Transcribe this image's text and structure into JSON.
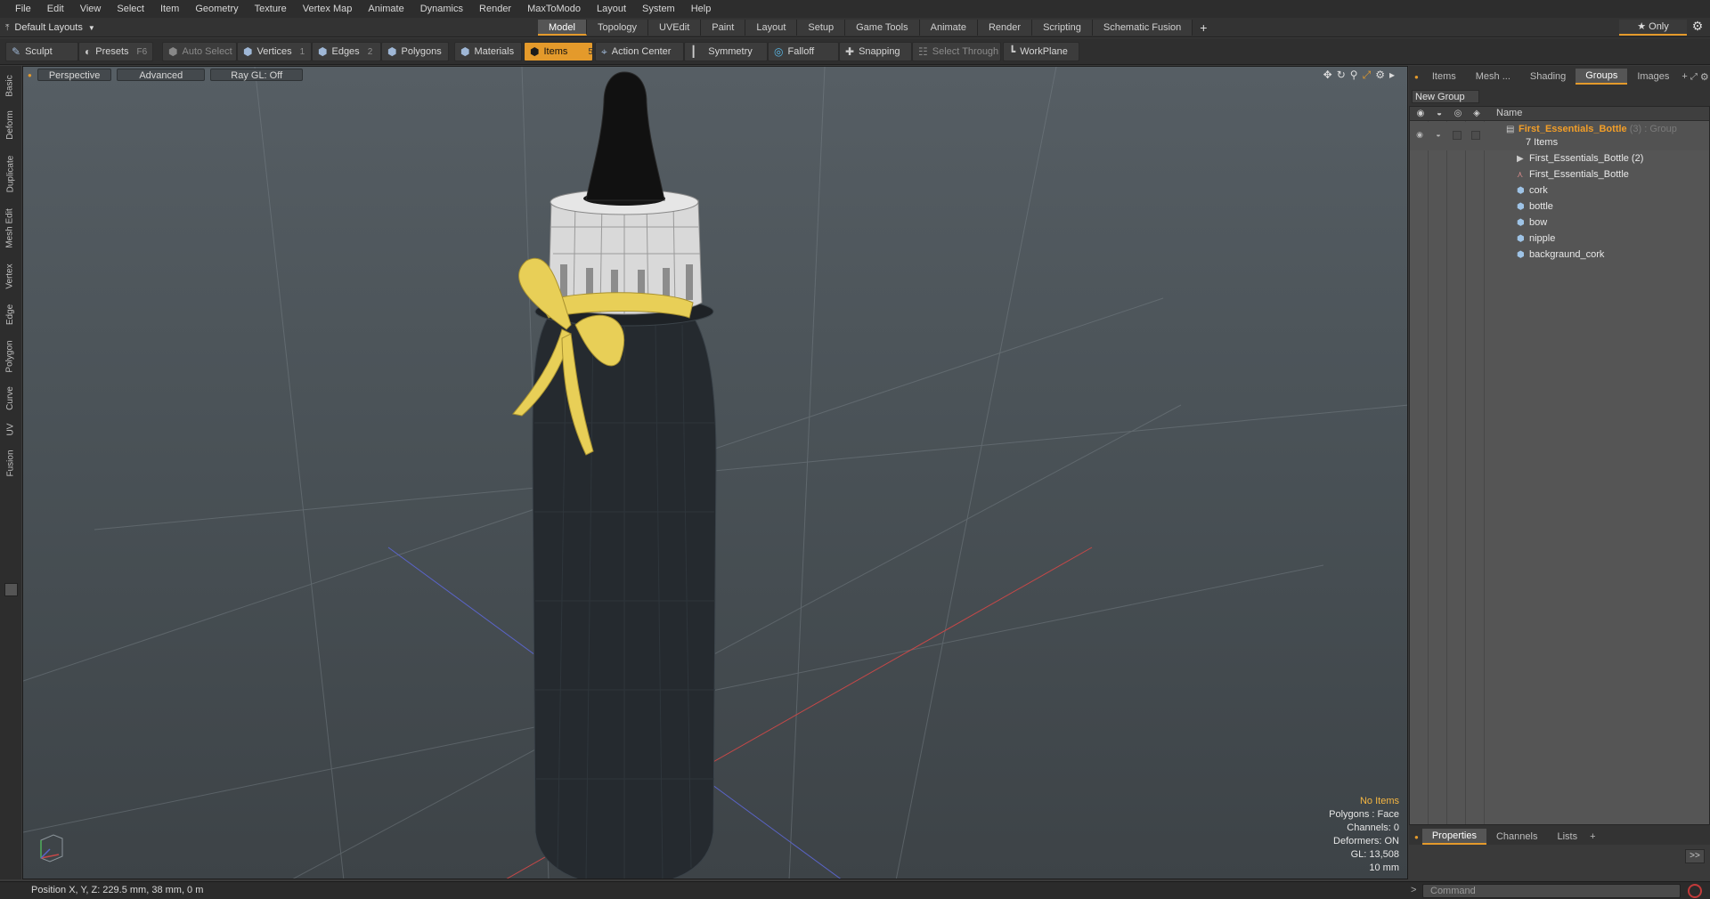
{
  "menubar": {
    "items": [
      "File",
      "Edit",
      "View",
      "Select",
      "Item",
      "Geometry",
      "Texture",
      "Vertex Map",
      "Animate",
      "Dynamics",
      "Render",
      "MaxToModo",
      "Layout",
      "System",
      "Help"
    ]
  },
  "layoutbar": {
    "layout_name": "Default Layouts",
    "tabs": [
      "Model",
      "Topology",
      "UVEdit",
      "Paint",
      "Layout",
      "Setup",
      "Game Tools",
      "Animate",
      "Render",
      "Scripting",
      "Schematic Fusion"
    ],
    "active_tab": "Model",
    "add_label": "+",
    "only_label": "★  Only"
  },
  "toolbar": {
    "sculpt": "Sculpt",
    "presets": "Presets",
    "presets_key": "F6",
    "auto_select": "Auto Select",
    "vertices": "Vertices",
    "vertices_key": "1",
    "edges": "Edges",
    "edges_key": "2",
    "polygons": "Polygons",
    "materials": "Materials",
    "items": "Items",
    "items_key": "5",
    "action_center": "Action Center",
    "symmetry": "Symmetry",
    "falloff": "Falloff",
    "snapping": "Snapping",
    "select_through": "Select Through",
    "workplane": "WorkPlane"
  },
  "left_tabs": [
    "Basic",
    "Deform",
    "Duplicate",
    "Mesh Edit",
    "Vertex",
    "Edge",
    "Polygon",
    "Curve",
    "UV",
    "Fusion"
  ],
  "viewport": {
    "view_label": "Perspective",
    "shading_label": "Advanced",
    "raygl_label": "Ray GL: Off",
    "stats": {
      "items": "No Items",
      "polygons": "Polygons : Face",
      "channels": "Channels: 0",
      "deformers": "Deformers: ON",
      "gl": "GL: 13,508",
      "grid": "10 mm"
    }
  },
  "right_panel": {
    "tabs": [
      "Items",
      "Mesh ...",
      "Shading",
      "Groups",
      "Images"
    ],
    "active_tab": "Groups",
    "new_group": "New Group",
    "name_header": "Name",
    "group": {
      "name": "First_Essentials_Bottle",
      "count_suffix": "(3) : Group",
      "items_count": "7 Items"
    },
    "items": [
      "First_Essentials_Bottle (2)",
      "First_Essentials_Bottle",
      "cork",
      "bottle",
      "bow",
      "nipple",
      "backgraund_cork"
    ],
    "bottom_tabs": [
      "Properties",
      "Channels",
      "Lists"
    ],
    "bottom_active": "Properties"
  },
  "statusbar": {
    "position_text": "Position X, Y, Z:   229.5 mm, 38 mm, 0 m",
    "command_placeholder": "Command",
    "prompt": ">"
  },
  "colors": {
    "accent": "#e49a2b",
    "group_label": "#f29e28",
    "bow": "#e8cf57",
    "bottle_body": "#252a2f",
    "cap": "#d9d9d9"
  }
}
